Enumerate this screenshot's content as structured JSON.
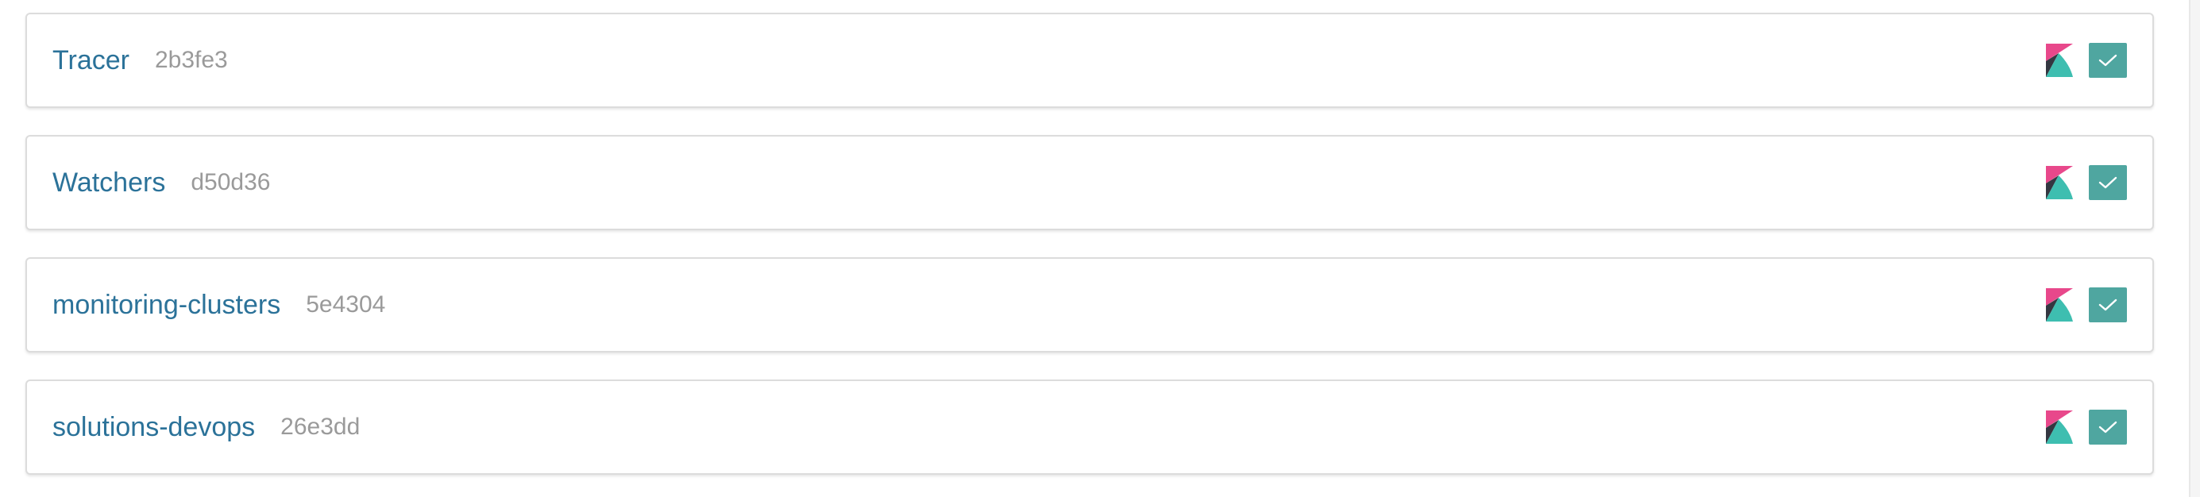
{
  "deployments": [
    {
      "name": "Tracer",
      "id": "2b3fe3",
      "app_icon": "kibana-logo-icon",
      "status_icon": "check-icon",
      "colors": {
        "pink": "#e8488b",
        "teal": "#3ebeb0",
        "dark": "#343741",
        "status": "#4fa6a0"
      }
    },
    {
      "name": "Watchers",
      "id": "d50d36",
      "app_icon": "kibana-logo-icon",
      "status_icon": "check-icon",
      "colors": {
        "pink": "#e8488b",
        "teal": "#3ebeb0",
        "dark": "#343741",
        "status": "#4fa6a0"
      }
    },
    {
      "name": "monitoring-clusters",
      "id": "5e4304",
      "app_icon": "kibana-logo-icon",
      "status_icon": "check-icon",
      "colors": {
        "pink": "#e8488b",
        "teal": "#3ebeb0",
        "dark": "#343741",
        "status": "#4fa6a0"
      }
    },
    {
      "name": "solutions-devops",
      "id": "26e3dd",
      "app_icon": "kibana-logo-icon",
      "status_icon": "check-icon",
      "colors": {
        "pink": "#e8488b",
        "teal": "#3ebeb0",
        "dark": "#343741",
        "status": "#4fa6a0"
      }
    }
  ]
}
